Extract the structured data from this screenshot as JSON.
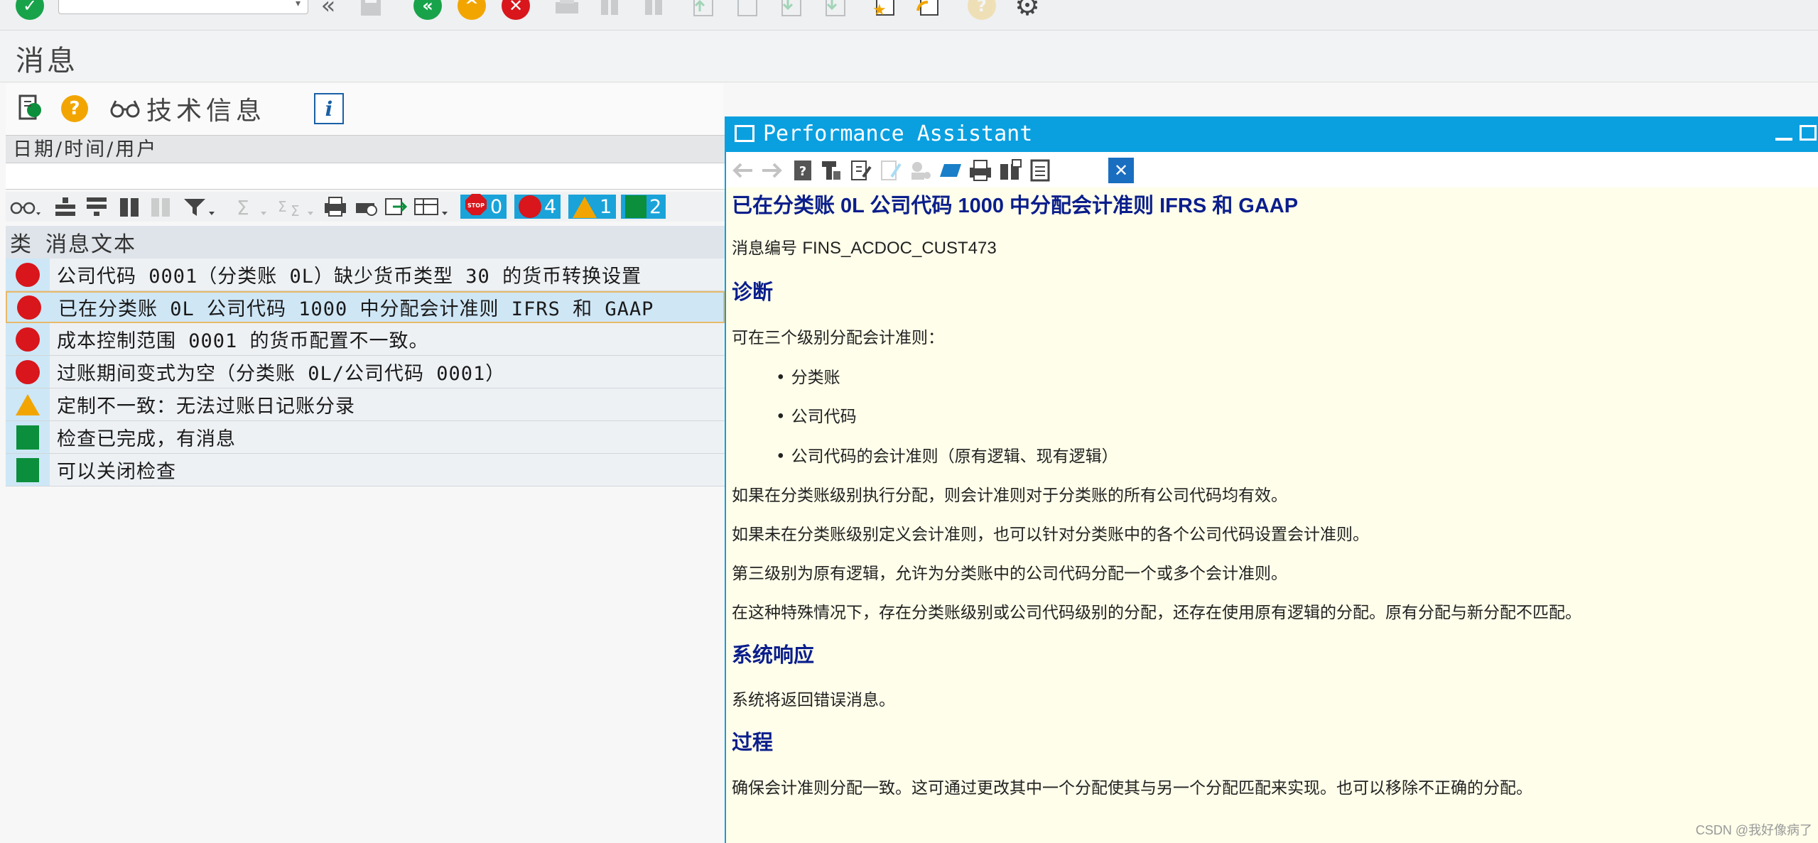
{
  "window": {
    "title": "消息"
  },
  "toolbar": {
    "icons": [
      "check-icon",
      "command-field",
      "double-back-icon",
      "save-icon",
      "back-icon",
      "exit-icon",
      "cancel-icon",
      "print-icon",
      "find-icon",
      "find-next-icon",
      "first-page-icon",
      "previous-page-icon",
      "next-page-icon",
      "last-page-icon",
      "create-session-icon",
      "shortcut-icon",
      "help-icon",
      "settings-icon"
    ]
  },
  "secondary_toolbar": {
    "tech_info_label": "技术信息"
  },
  "date_header": {
    "label": "日期/时间/用户"
  },
  "alv": {
    "counts": {
      "stop": "0",
      "error": "4",
      "warning": "1",
      "success": "2"
    }
  },
  "table": {
    "headers": {
      "type": "类",
      "text": "消息文本"
    },
    "rows": [
      {
        "status": "error",
        "text": "公司代码 0001（分类账 0L）缺少货币类型 30 的货币转换设置"
      },
      {
        "status": "error",
        "text": "已在分类账 0L 公司代码 1000 中分配会计准则 IFRS 和 GAAP",
        "selected": true
      },
      {
        "status": "error",
        "text": "成本控制范围 0001 的货币配置不一致。"
      },
      {
        "status": "error",
        "text": "过账期间变式为空（分类账 0L/公司代码 0001）"
      },
      {
        "status": "warning",
        "text": "定制不一致：无法过账日记账分录"
      },
      {
        "status": "success",
        "text": "检查已完成，有消息"
      },
      {
        "status": "success",
        "text": "可以关闭检查"
      }
    ]
  },
  "assistant": {
    "title": "Performance Assistant",
    "heading": "已在分类账 0L 公司代码 1000 中分配会计准则 IFRS 和 GAAP",
    "message_no_label": "消息编号",
    "message_no": "FINS_ACDOC_CUST473",
    "diagnosis_title": "诊断",
    "diagnosis_intro": "可在三个级别分配会计准则：",
    "bullets": [
      "分类账",
      "公司代码",
      "公司代码的会计准则（原有逻辑、现有逻辑）"
    ],
    "para1": "如果在分类账级别执行分配，则会计准则对于分类账的所有公司代码均有效。",
    "para2": "如果未在分类账级别定义会计准则，也可以针对分类账中的各个公司代码设置会计准则。",
    "para3": "第三级别为原有逻辑，允许为分类账中的公司代码分配一个或多个会计准则。",
    "para4": "在这种特殊情况下，存在分类账级别或公司代码级别的分配，还存在使用原有逻辑的分配。原有分配与新分配不匹配。",
    "response_title": "系统响应",
    "response_text": "系统将返回错误消息。",
    "procedure_title": "过程",
    "procedure_text": "确保会计准则分配一致。这可通过更改其中一个分配使其与另一个分配匹配来实现。也可以移除不正确的分配。"
  },
  "watermark": "CSDN @我好像病了",
  "colors": {
    "accent": "#0aa0e0",
    "error": "#d8161b",
    "warning": "#f2a500",
    "success": "#0b8f3c",
    "heading": "#0a1e8c",
    "assistant_bg": "#fffeea"
  }
}
